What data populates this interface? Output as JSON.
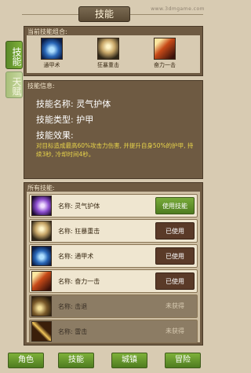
{
  "watermark": "www.3dmgame.com",
  "title": "技能",
  "side_tabs": [
    {
      "label": "技能",
      "active": true
    },
    {
      "label": "天赋",
      "active": false
    }
  ],
  "combo": {
    "label": "当前技能组合:",
    "slots": [
      {
        "name": "通甲术",
        "icon": "armor-skill-icon"
      },
      {
        "name": "狂暴重击",
        "icon": "frenzy-strike-icon"
      },
      {
        "name": "奋力一击",
        "icon": "power-strike-icon"
      }
    ]
  },
  "info": {
    "label": "技能信息:",
    "name_line": "技能名称: 灵气护体",
    "type_line": "技能类型: 护甲",
    "effect_label": "技能效果:",
    "effect_text": "对目标造成最高60%攻击力伤害, 并提升自身50%的护甲, 持续3秒, 冷却时间4秒。"
  },
  "all_skills": {
    "label": "所有技能:",
    "rows": [
      {
        "name": "名称: 灵气护体",
        "status": "使用技能",
        "state": "use",
        "icon": "spirit-aura-icon"
      },
      {
        "name": "名称: 狂暴重击",
        "status": "已使用",
        "state": "used",
        "icon": "frenzy-strike-icon"
      },
      {
        "name": "名称: 通甲术",
        "status": "已使用",
        "state": "used",
        "icon": "armor-skill-icon"
      },
      {
        "name": "名称: 奋力一击",
        "status": "已使用",
        "state": "used",
        "icon": "power-strike-icon"
      },
      {
        "name": "名称: 击退",
        "status": "未获得",
        "state": "none",
        "icon": "hit-icon"
      },
      {
        "name": "名称: 雷击",
        "status": "未获得",
        "state": "none",
        "icon": "thunder-icon"
      }
    ]
  },
  "nav": [
    "角色",
    "技能",
    "城镇",
    "冒险"
  ]
}
